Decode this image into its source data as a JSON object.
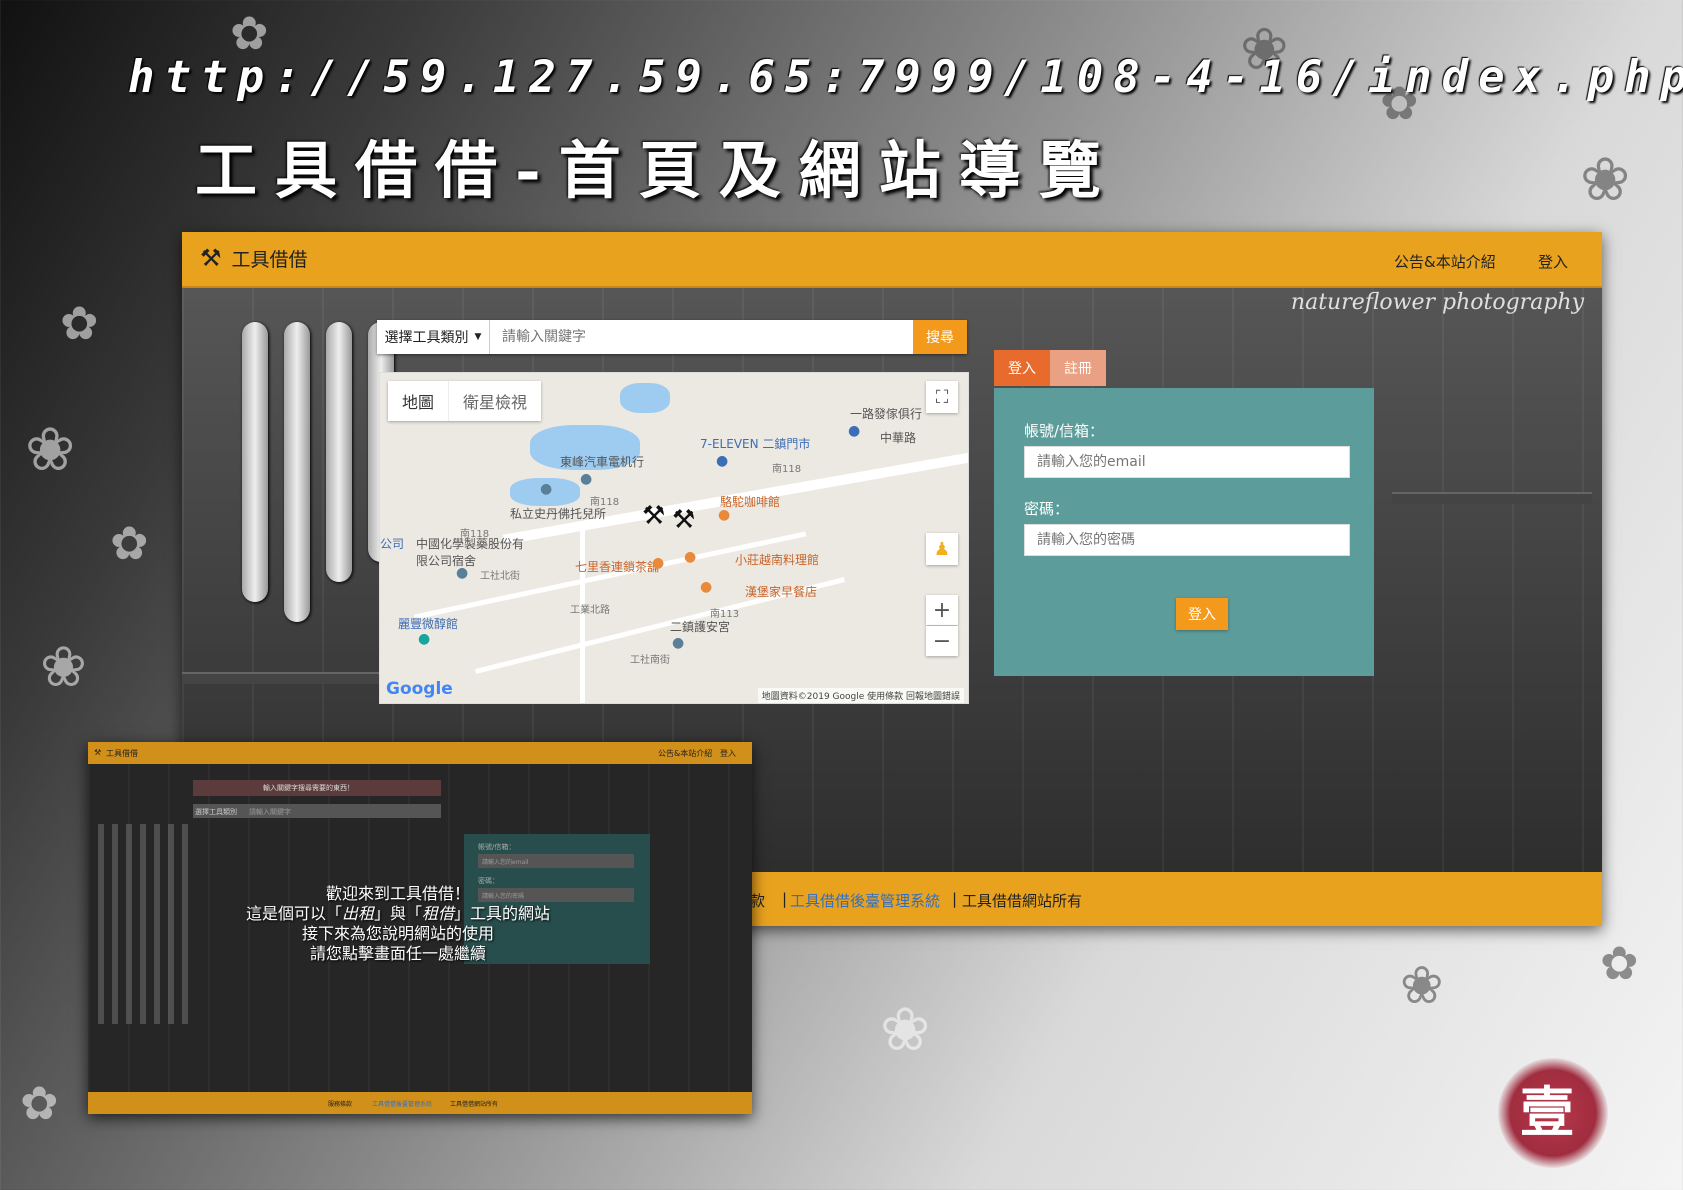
{
  "header": {
    "url_text": "http://59.127.59.65:7999/108-4-16/index.php",
    "heading": "工具借借-首頁及網站導覽"
  },
  "app": {
    "brand": "工具借借",
    "brand_icon": "hammer-wrench-icon",
    "nav": [
      "公告&本站介紹",
      "登入"
    ],
    "watermark": "natureflower photography"
  },
  "search": {
    "category_label": "選擇工具類別",
    "placeholder": "請輸入關鍵字",
    "button": "搜尋"
  },
  "map": {
    "type_map": "地圖",
    "type_satellite": "衛星檢視",
    "labels": [
      "一路發傢俱行",
      "中華路",
      "7-ELEVEN 二鎮門市",
      "東峰汽車電机行",
      "私立史丹佛托兒所",
      "駱駝咖啡館",
      "中國化學製藥股份有限公司宿舍",
      "七里香連鎖茶舖",
      "小莊越南料理館",
      "漢堡家早餐店",
      "麗豐微醇館",
      "二鎮護安宮",
      "工社北街",
      "工業北路",
      "工社南街",
      "公司"
    ],
    "road_labels": [
      "南118",
      "南118",
      "南118",
      "南113"
    ],
    "logo": "Google",
    "footer": "地圖資料©2019 Google  使用條款  回報地圖錯誤"
  },
  "auth": {
    "tab_login": "登入",
    "tab_register": "註冊",
    "account_label": "帳號/信箱：",
    "account_placeholder": "請輸入您的email",
    "password_label": "密碼：",
    "password_placeholder": "請輸入您的密碼",
    "submit": "登入"
  },
  "footer": {
    "link_partial": "款",
    "admin_link": "工具借借後臺管理系統",
    "copyright": "工具借借網站所有"
  },
  "mini": {
    "brand": "工具借借",
    "nav": [
      "公告&本站介紹",
      "登入"
    ],
    "alert": "輸入關鍵字搜尋需要的東西！",
    "search_label": "選擇工具類別",
    "search_placeholder": "請輸入關鍵字",
    "account_label": "帳號/信箱：",
    "account_placeholder": "請輸入您的email",
    "password_label": "密碼：",
    "password_placeholder": "請輸入您的密碼",
    "welcome_line1": "歡迎來到工具借借！",
    "welcome_line2_a": "這是個可以「",
    "welcome_line2_rent_out": "出租",
    "welcome_line2_b": "」與「",
    "welcome_line2_rent": "租借",
    "welcome_line2_c": "」工具的網站",
    "welcome_line3": "接下來為您說明網站的使用",
    "welcome_line4": "請您點擊畫面任一處繼續",
    "footer": [
      "服務條款",
      "工具借借後臺管理系統",
      "工具借借網站所有"
    ]
  },
  "stamp": "壹",
  "colors": {
    "nav_orange": "#e8a21e",
    "button_orange": "#f39a1c",
    "panel_teal": "#5c9c9a",
    "tab_active": "#e86b2e",
    "link_blue": "#2f6fc4",
    "stamp_red": "#a02d3f"
  }
}
